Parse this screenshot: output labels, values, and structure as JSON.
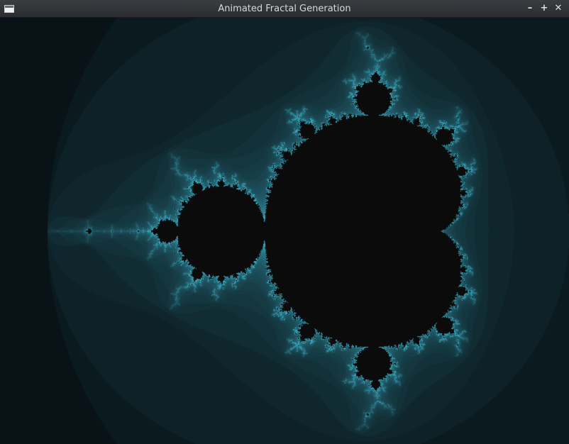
{
  "window": {
    "title": "Animated Fractal Generation",
    "controls": {
      "minimize_glyph": "–",
      "maximize_glyph": "+",
      "close_glyph": "✕"
    }
  },
  "fractal": {
    "type": "mandelbrot",
    "palette": {
      "background": "#050709",
      "set_color": "#0b0b0c",
      "edge_color": "#3aa8c0"
    }
  }
}
